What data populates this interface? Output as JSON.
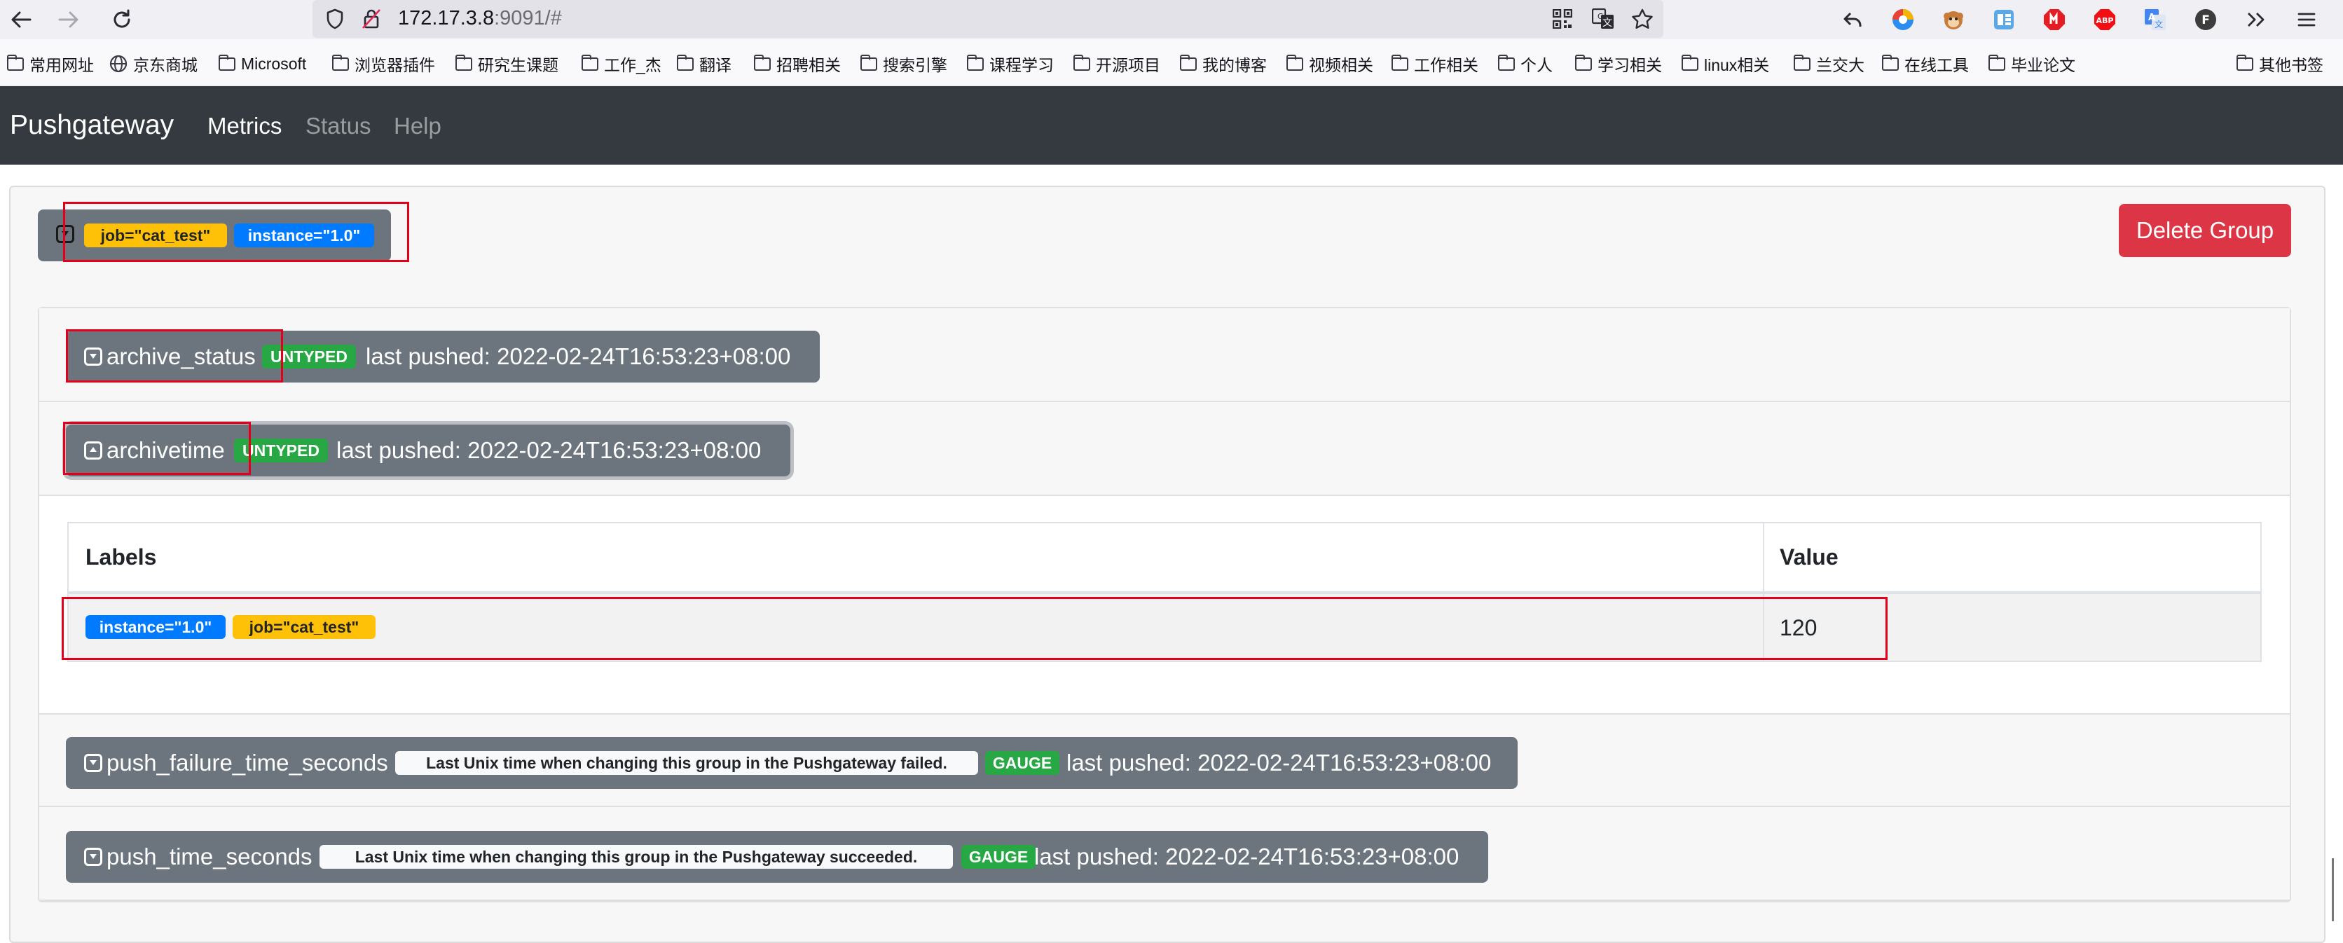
{
  "browser": {
    "url_host": "172.17.3.8",
    "url_rest": ":9091/#"
  },
  "bookmarks": [
    "常用网址",
    "京东商城",
    "Microsoft",
    "浏览器插件",
    "研究生课题",
    "工作_杰",
    "翻译",
    "招聘相关",
    "搜索引擎",
    "课程学习",
    "开源项目",
    "我的博客",
    "视频相关",
    "工作相关",
    "个人",
    "学习相关",
    "linux相关",
    "兰交大",
    "在线工具",
    "毕业论文",
    "其他书签"
  ],
  "navbar": {
    "brand": "Pushgateway",
    "links": [
      "Metrics",
      "Status",
      "Help"
    ]
  },
  "group": {
    "labels": [
      "job=\"cat_test\"",
      "instance=\"1.0\""
    ],
    "delete_label": "Delete Group"
  },
  "metrics": [
    {
      "name": "archive_status",
      "type": "UNTYPED",
      "pushed": "last pushed: 2022-02-24T16:53:23+08:00",
      "help": "",
      "expanded": false
    },
    {
      "name": "archivetime",
      "type": "UNTYPED",
      "pushed": "last pushed: 2022-02-24T16:53:23+08:00",
      "help": "",
      "expanded": true
    },
    {
      "name": "push_failure_time_seconds",
      "type": "GAUGE",
      "pushed": "last pushed: 2022-02-24T16:53:23+08:00",
      "help": "Last Unix time when changing this group in the Pushgateway failed.",
      "expanded": false
    },
    {
      "name": "push_time_seconds",
      "type": "GAUGE",
      "pushed": "last pushed: 2022-02-24T16:53:23+08:00",
      "help": "Last Unix time when changing this group in the Pushgateway succeeded.",
      "expanded": false
    }
  ],
  "table": {
    "headers": [
      "Labels",
      "Value"
    ],
    "rows": [
      {
        "labels": [
          "instance=\"1.0\"",
          "job=\"cat_test\""
        ],
        "value": "120"
      }
    ]
  },
  "colors": {
    "navbar": "#343a40",
    "secondary": "#6c757d",
    "danger": "#dc3545",
    "warning": "#ffc107",
    "primary": "#007bff",
    "success": "#28a745",
    "annotation": "#e3001b"
  }
}
